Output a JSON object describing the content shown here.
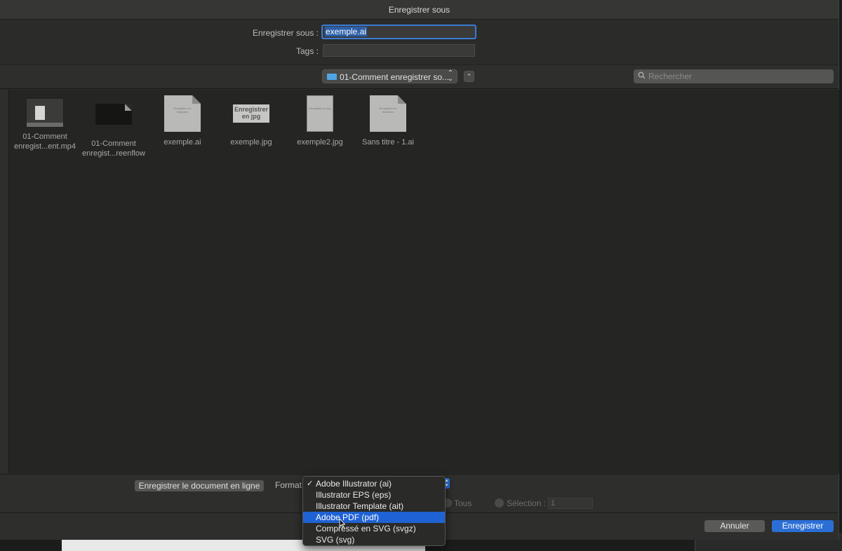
{
  "window": {
    "title": "Enregistrer sous"
  },
  "save_as": {
    "label": "Enregistrer sous :",
    "value": "exemple.ai"
  },
  "tags": {
    "label": "Tags :",
    "value": ""
  },
  "location": {
    "folder": "01-Comment enregistrer so...",
    "chevron": "⌃⌄",
    "up": "⌃"
  },
  "search": {
    "placeholder": "Rechercher"
  },
  "files": [
    {
      "name_line1": "01-Comment",
      "name_line2": "enregist...ent.mp4",
      "kind": "video"
    },
    {
      "name_line1": "01-Comment",
      "name_line2": "enregist...reenflow",
      "kind": "screenflow"
    },
    {
      "name_line1": "exemple.ai",
      "name_line2": "",
      "kind": "ai",
      "thumb_text": "Enregistrer en illustrator"
    },
    {
      "name_line1": "exemple.jpg",
      "name_line2": "",
      "kind": "jpg",
      "thumb_text": "Enregistrer en jpg"
    },
    {
      "name_line1": "exemple2.jpg",
      "name_line2": "",
      "kind": "jpg2",
      "thumb_text": "Enregistrer en jpg"
    },
    {
      "name_line1": "Sans titre - 1.ai",
      "name_line2": "",
      "kind": "ai",
      "thumb_text": "Enregistrer en illustrator"
    }
  ],
  "bottom": {
    "online_button": "Enregistrer le document en ligne",
    "format_label": "Format",
    "radio_all": "Tous",
    "radio_selection": "Sélection :",
    "range_value": "1"
  },
  "format_menu": {
    "checkmark": "✓",
    "selected_index": 0,
    "highlighted_index": 3,
    "items": [
      "Adobe Illustrator (ai)",
      "Illustrator EPS (eps)",
      "Illustrator Template (ait)",
      "Adobe PDF (pdf)",
      "Compressé en SVG (svgz)",
      "SVG (svg)"
    ]
  },
  "buttons": {
    "cancel": "Annuler",
    "save": "Enregistrer"
  },
  "colors": {
    "accent": "#2b6fd6",
    "background": "#2b2b29",
    "folder": "#4fa6e6"
  }
}
